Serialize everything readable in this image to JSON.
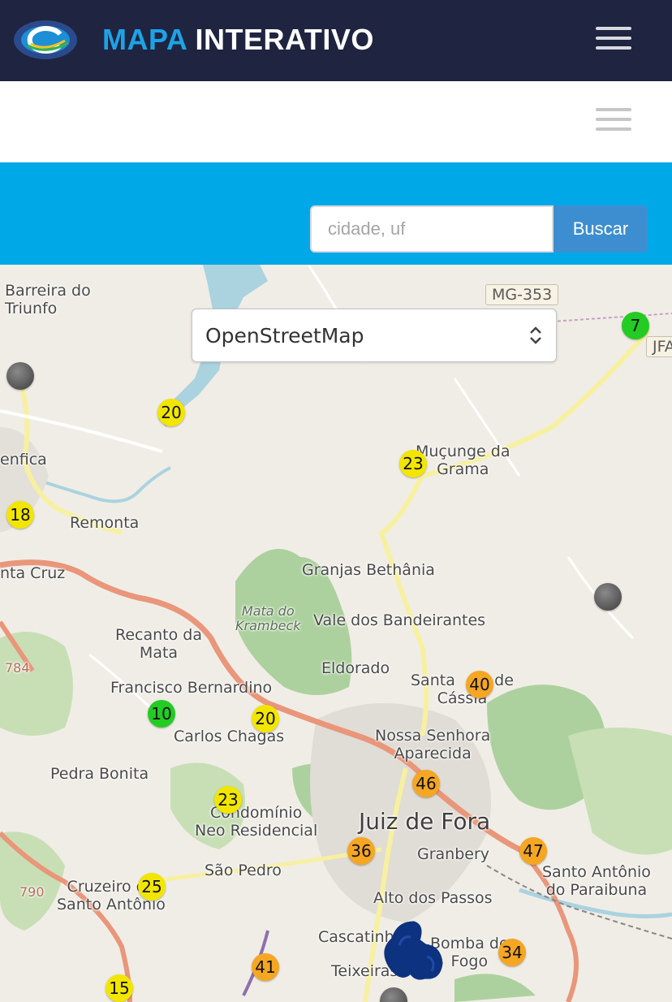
{
  "header": {
    "brand_part1": "MAPA",
    "brand_part2": "INTERATIVO",
    "logo_name": "logo-icon",
    "menu_icon": "hamburger-menu-icon"
  },
  "subheader": {
    "menu_icon": "hamburger-menu-icon"
  },
  "search": {
    "placeholder": "cidade, uf",
    "value": "",
    "button_label": "Buscar"
  },
  "map": {
    "layer_select": {
      "selected": "OpenStreetMap"
    },
    "road_shields": [
      "MG-353",
      "JFA"
    ],
    "road_numbers": [
      "784",
      "790"
    ],
    "place_labels": {
      "barreira": "Barreira do\nTriunfo",
      "benfica": "enfica",
      "remonta": "Remonta",
      "santacruz": "nta Cruz",
      "mucunge": "Muçunge da\nGrama",
      "granjas": "Granjas Bethânia",
      "mata": "Mata do\nKrambeck",
      "vale": "Vale dos Bandeirantes",
      "recanto": "Recanto da\nMata",
      "eldorado": "Eldorado",
      "santacassia": "Santa        de\nCássia",
      "francisco": "Francisco Bernardino",
      "carlos": "Carlos Chagas",
      "nossa": "Nossa Senhora\nAparecida",
      "pedra": "Pedra Bonita",
      "condominio": "Condomínio\nNeo Residencial",
      "juiz": "Juiz de Fora",
      "granbery": "Granbery",
      "santoantonio_r": "Santo Antônio\ndo Paraibuna",
      "saopedro": "São Pedro",
      "cruzeiro": "Cruzeiro do\nSanto Antônio",
      "altodospassos": "Alto dos Passos",
      "cascatinha": "Cascatinha",
      "bomba": "Bomba de\nFogo",
      "teixeiras": "Teixeiras"
    },
    "markers": [
      {
        "value": "7",
        "level": "green"
      },
      {
        "value": "20",
        "level": "yellow"
      },
      {
        "value": "23",
        "level": "yellow"
      },
      {
        "value": "18",
        "level": "yellow"
      },
      {
        "value": "40",
        "level": "orange"
      },
      {
        "value": "10",
        "level": "green"
      },
      {
        "value": "20",
        "level": "yellow"
      },
      {
        "value": "46",
        "level": "orange"
      },
      {
        "value": "23",
        "level": "yellow"
      },
      {
        "value": "36",
        "level": "orange"
      },
      {
        "value": "47",
        "level": "orange"
      },
      {
        "value": "25",
        "level": "yellow"
      },
      {
        "value": "34",
        "level": "orange"
      },
      {
        "value": "41",
        "level": "orange"
      },
      {
        "value": "15",
        "level": "yellow"
      }
    ],
    "no_data_marker_icon": "gray-station-marker-icon",
    "location_pin_icon": "location-pin-icon",
    "colors": {
      "green": "#22cc22",
      "yellow": "#f2e600",
      "orange": "#f5a623",
      "header": "#1f2440",
      "bluebar": "#00a8e8"
    }
  }
}
